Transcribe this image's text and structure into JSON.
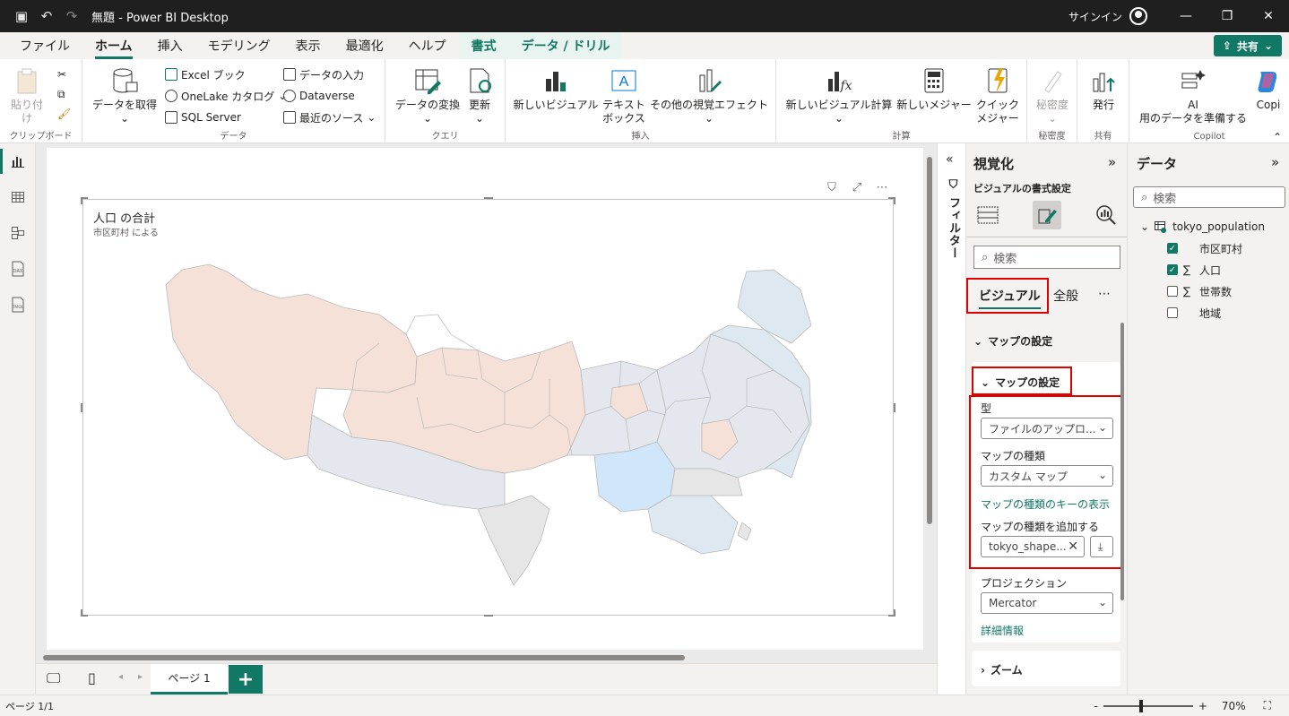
{
  "titlebar": {
    "title": "無題 - Power BI Desktop",
    "signin": "サインイン"
  },
  "menu": {
    "tabs": [
      "ファイル",
      "ホーム",
      "挿入",
      "モデリング",
      "表示",
      "最適化",
      "ヘルプ",
      "書式",
      "データ / ドリル"
    ],
    "active": "ホーム",
    "share": "共有"
  },
  "ribbon": {
    "clipboard": {
      "paste": "貼り付け",
      "label": "クリップボード"
    },
    "data": {
      "get_data": "データを取得",
      "excel": "Excel ブック",
      "onelake": "OneLake カタログ",
      "sql": "SQL Server",
      "enter_data": "データの入力",
      "dataverse": "Dataverse",
      "recent": "最近のソース",
      "label": "データ"
    },
    "query": {
      "transform": "データの変換",
      "refresh": "更新",
      "label": "クエリ"
    },
    "insert": {
      "new_visual": "新しいビジュアル",
      "textbox_1": "テキスト",
      "textbox_2": "ボックス",
      "more_visuals": "その他の視覚エフェクト",
      "label": "挿入"
    },
    "calc": {
      "new_visual_calc": "新しいビジュアル計算",
      "new_measure": "新しいメジャー",
      "quick_1": "クイック",
      "quick_2": "メジャー",
      "label": "計算"
    },
    "sensitivity": {
      "btn": "秘密度",
      "label": "秘密度"
    },
    "share": {
      "publish": "発行",
      "label": "共有"
    },
    "copilot": {
      "ai_1": "AI",
      "ai_2": "用のデータを準備する",
      "copilot": "Copi",
      "label": "Copilot"
    }
  },
  "visual": {
    "title": "人口 の合計",
    "subtitle": "市区町村 による"
  },
  "filter_pane": {
    "label": "フィルター"
  },
  "viz_pane": {
    "title": "視覚化",
    "subtitle": "ビジュアルの書式設定",
    "search_placeholder": "検索",
    "tab_visual": "ビジュアル",
    "tab_general": "全般",
    "section_outer": "マップの設定",
    "section_inner": "マップの設定",
    "type_label": "型",
    "type_value": "ファイルのアップロ...",
    "map_kind_label": "マップの種類",
    "map_kind_value": "カスタム マップ",
    "map_key_link": "マップの種類のキーの表示",
    "add_map_label": "マップの種類を追加する",
    "add_map_value": "tokyo_shape...",
    "projection_label": "プロジェクション",
    "projection_value": "Mercator",
    "details_link": "詳細情報",
    "zoom_section": "ズーム"
  },
  "data_pane": {
    "title": "データ",
    "search_placeholder": "検索",
    "table": "tokyo_population",
    "fields": [
      {
        "name": "市区町村",
        "checked": true,
        "sigma": false
      },
      {
        "name": "人口",
        "checked": true,
        "sigma": true
      },
      {
        "name": "世帯数",
        "checked": false,
        "sigma": true
      },
      {
        "name": "地域",
        "checked": false,
        "sigma": false
      }
    ]
  },
  "pages": {
    "tab": "ページ 1",
    "status": "ページ 1/1"
  },
  "zoom": {
    "level": "70%"
  },
  "colors": {
    "accent": "#117865",
    "highlight": "#e00000",
    "west": "#f6e1d8",
    "center": "#e4e8ee",
    "east": "#dde8f1",
    "islands": "#e6e6e6",
    "selected_ward": "#cfe6fb"
  }
}
